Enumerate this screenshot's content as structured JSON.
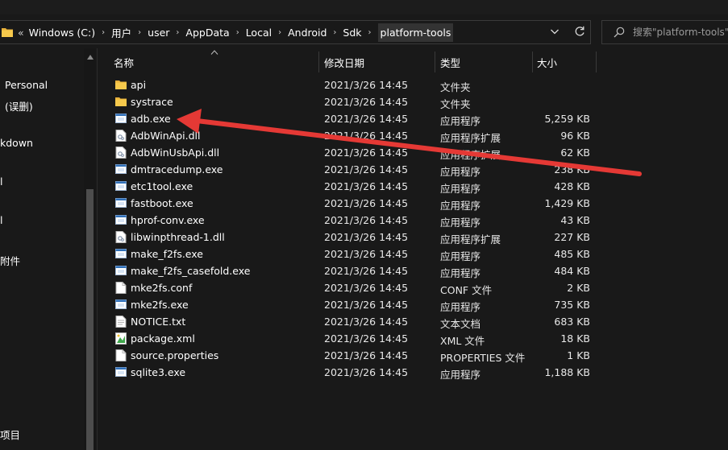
{
  "address": {
    "breadcrumbs": [
      "Windows (C:)",
      "用户",
      "user",
      "AppData",
      "Local",
      "Android",
      "Sdk",
      "platform-tools"
    ],
    "chevron": "«",
    "separator": "›"
  },
  "search": {
    "placeholder": "搜索\"platform-tools\""
  },
  "sidebar": {
    "items": [
      "Personal",
      "(误删)",
      "kdown",
      "l",
      "l",
      "附件",
      "项目"
    ]
  },
  "columns": {
    "name": "名称",
    "date": "修改日期",
    "type": "类型",
    "size": "大小"
  },
  "files": [
    {
      "name": "api",
      "date": "2021/3/26 14:45",
      "type": "文件夹",
      "size": "",
      "icon": "folder-icon"
    },
    {
      "name": "systrace",
      "date": "2021/3/26 14:45",
      "type": "文件夹",
      "size": "",
      "icon": "folder-icon"
    },
    {
      "name": "adb.exe",
      "date": "2021/3/26 14:45",
      "type": "应用程序",
      "size": "5,259 KB",
      "icon": "exe-icon"
    },
    {
      "name": "AdbWinApi.dll",
      "date": "2021/3/26 14:45",
      "type": "应用程序扩展",
      "size": "96 KB",
      "icon": "dll-icon"
    },
    {
      "name": "AdbWinUsbApi.dll",
      "date": "2021/3/26 14:45",
      "type": "应用程序扩展",
      "size": "62 KB",
      "icon": "dll-icon"
    },
    {
      "name": "dmtracedump.exe",
      "date": "2021/3/26 14:45",
      "type": "应用程序",
      "size": "238 KB",
      "icon": "exe-icon"
    },
    {
      "name": "etc1tool.exe",
      "date": "2021/3/26 14:45",
      "type": "应用程序",
      "size": "428 KB",
      "icon": "exe-icon"
    },
    {
      "name": "fastboot.exe",
      "date": "2021/3/26 14:45",
      "type": "应用程序",
      "size": "1,429 KB",
      "icon": "exe-icon"
    },
    {
      "name": "hprof-conv.exe",
      "date": "2021/3/26 14:45",
      "type": "应用程序",
      "size": "43 KB",
      "icon": "exe-icon"
    },
    {
      "name": "libwinpthread-1.dll",
      "date": "2021/3/26 14:45",
      "type": "应用程序扩展",
      "size": "227 KB",
      "icon": "dll-icon"
    },
    {
      "name": "make_f2fs.exe",
      "date": "2021/3/26 14:45",
      "type": "应用程序",
      "size": "485 KB",
      "icon": "exe-icon"
    },
    {
      "name": "make_f2fs_casefold.exe",
      "date": "2021/3/26 14:45",
      "type": "应用程序",
      "size": "484 KB",
      "icon": "exe-icon"
    },
    {
      "name": "mke2fs.conf",
      "date": "2021/3/26 14:45",
      "type": "CONF 文件",
      "size": "2 KB",
      "icon": "file-icon"
    },
    {
      "name": "mke2fs.exe",
      "date": "2021/3/26 14:45",
      "type": "应用程序",
      "size": "735 KB",
      "icon": "exe-icon"
    },
    {
      "name": "NOTICE.txt",
      "date": "2021/3/26 14:45",
      "type": "文本文档",
      "size": "683 KB",
      "icon": "text-icon"
    },
    {
      "name": "package.xml",
      "date": "2021/3/26 14:45",
      "type": "XML 文件",
      "size": "18 KB",
      "icon": "xml-icon"
    },
    {
      "name": "source.properties",
      "date": "2021/3/26 14:45",
      "type": "PROPERTIES 文件",
      "size": "1 KB",
      "icon": "file-icon"
    },
    {
      "name": "sqlite3.exe",
      "date": "2021/3/26 14:45",
      "type": "应用程序",
      "size": "1,188 KB",
      "icon": "exe-icon"
    }
  ],
  "annotation": {
    "color": "#e53935",
    "target": "adb.exe"
  }
}
